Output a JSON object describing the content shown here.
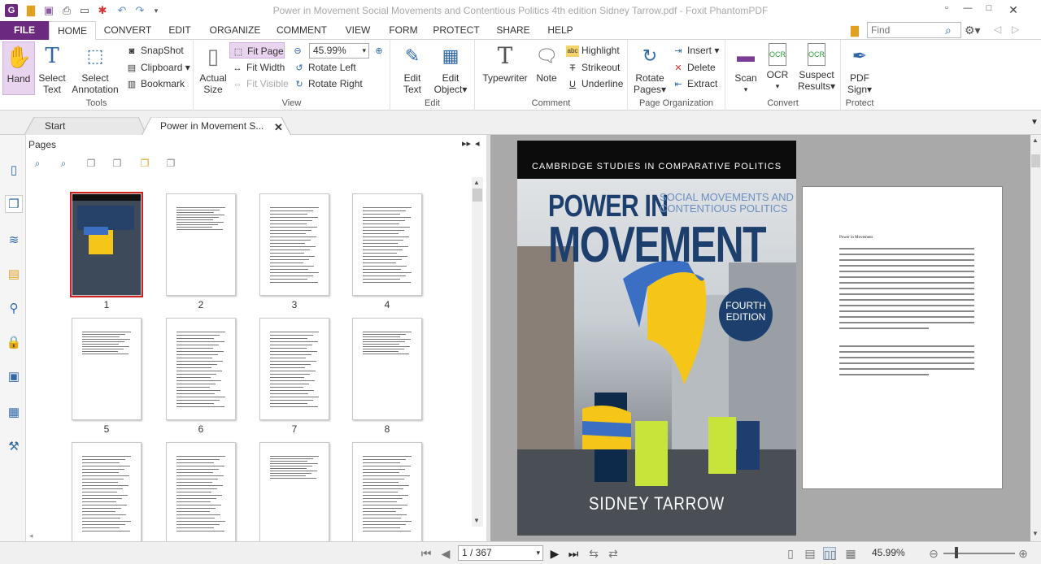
{
  "window": {
    "title": "Power in Movement Social Movements and Contentious Politics 4th edition  Sidney Tarrow.pdf - Foxit PhantomPDF"
  },
  "ribbon_tabs": [
    {
      "label": "FILE"
    },
    {
      "label": "HOME"
    },
    {
      "label": "CONVERT"
    },
    {
      "label": "EDIT"
    },
    {
      "label": "ORGANIZE"
    },
    {
      "label": "COMMENT"
    },
    {
      "label": "VIEW"
    },
    {
      "label": "FORM"
    },
    {
      "label": "PROTECT"
    },
    {
      "label": "SHARE"
    },
    {
      "label": "HELP"
    }
  ],
  "find": {
    "placeholder": "Find"
  },
  "groups": {
    "tools": {
      "label": "Tools",
      "hand": "Hand",
      "select_text_1": "Select",
      "select_text_2": "Text",
      "select_ann_1": "Select",
      "select_ann_2": "Annotation",
      "snapshot": "SnapShot",
      "clipboard": "Clipboard",
      "bookmark": "Bookmark"
    },
    "view": {
      "label": "View",
      "actual_1": "Actual",
      "actual_2": "Size",
      "fit_page": "Fit Page",
      "fit_width": "Fit Width",
      "fit_visible": "Fit Visible",
      "zoom": "45.99%",
      "rotate_left": "Rotate Left",
      "rotate_right": "Rotate Right"
    },
    "edit": {
      "label": "Edit",
      "edit_text_1": "Edit",
      "edit_text_2": "Text",
      "edit_obj_1": "Edit",
      "edit_obj_2": "Object"
    },
    "comment": {
      "label": "Comment",
      "typewriter": "Typewriter",
      "note": "Note",
      "highlight": "Highlight",
      "strikeout": "Strikeout",
      "underline": "Underline"
    },
    "page_org": {
      "label": "Page Organization",
      "rotate_1": "Rotate",
      "rotate_2": "Pages",
      "insert": "Insert",
      "delete": "Delete",
      "extract": "Extract"
    },
    "convert": {
      "label": "Convert",
      "scan": "Scan",
      "ocr": "OCR",
      "suspect_1": "Suspect",
      "suspect_2": "Results"
    },
    "protect": {
      "label": "Protect",
      "pdfsign_1": "PDF",
      "pdfsign_2": "Sign"
    }
  },
  "doc_tabs": [
    {
      "label": "Start"
    },
    {
      "label": "Power in Movement S..."
    }
  ],
  "pages_panel": {
    "title": "Pages",
    "thumbnails": [
      {
        "label": "1"
      },
      {
        "label": "2"
      },
      {
        "label": "3"
      },
      {
        "label": "4"
      },
      {
        "label": "5"
      },
      {
        "label": "6"
      },
      {
        "label": "7"
      },
      {
        "label": "8"
      },
      {
        "label": ""
      },
      {
        "label": ""
      },
      {
        "label": ""
      },
      {
        "label": ""
      }
    ]
  },
  "cover": {
    "series": "CAMBRIDGE STUDIES IN COMPARATIVE POLITICS",
    "title_1": "POWER IN",
    "title_2": "MOVEMENT",
    "subtitle_1": "SOCIAL MOVEMENTS AND",
    "subtitle_2": "CONTENTIOUS POLITICS",
    "edition_1": "FOURTH",
    "edition_2": "EDITION",
    "author": "SIDNEY TARROW"
  },
  "page2": {
    "heading": "Power in Movement"
  },
  "status": {
    "page": "1 / 367",
    "zoom": "45.99%"
  }
}
